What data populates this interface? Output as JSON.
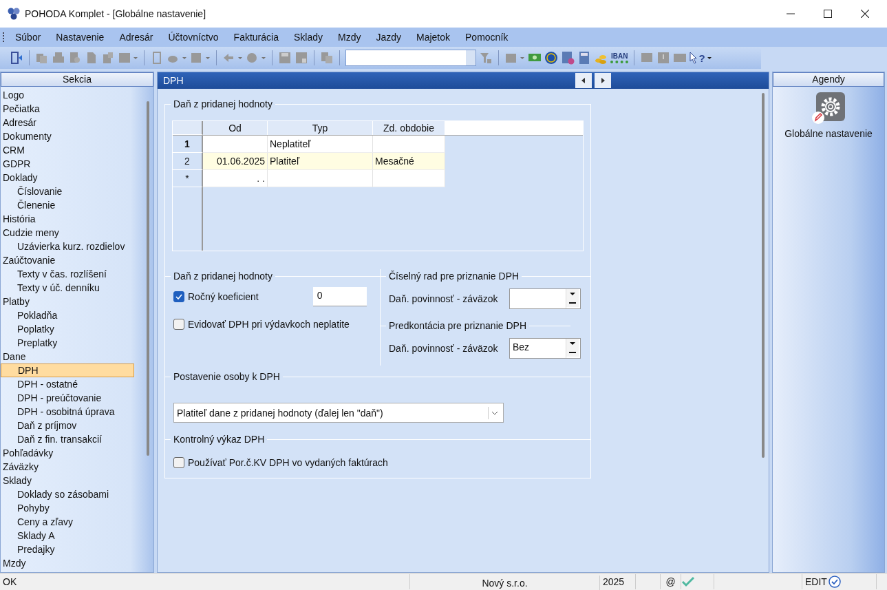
{
  "window": {
    "title": "POHODA Komplet - [Globálne nastavenie]"
  },
  "menu": [
    "Súbor",
    "Nastavenie",
    "Adresár",
    "Účtovníctvo",
    "Fakturácia",
    "Sklady",
    "Mzdy",
    "Jazdy",
    "Majetok",
    "Pomocník"
  ],
  "toolbar": {
    "iban_label": "IBAN",
    "help_mark": "?"
  },
  "sidebar": {
    "title": "Sekcia",
    "items": [
      {
        "label": "Logo",
        "selected": false
      },
      {
        "label": "Pečiatka",
        "selected": false
      },
      {
        "label": "Adresár",
        "selected": false
      },
      {
        "label": "Dokumenty",
        "selected": false
      },
      {
        "label": "CRM",
        "selected": false
      },
      {
        "label": "GDPR",
        "selected": false
      },
      {
        "label": "Doklady",
        "selected": false,
        "children": [
          {
            "label": "Číslovanie",
            "selected": false
          },
          {
            "label": "Členenie",
            "selected": false
          }
        ]
      },
      {
        "label": "História",
        "selected": false
      },
      {
        "label": "Cudzie meny",
        "selected": false,
        "children": [
          {
            "label": "Uzávierka kurz. rozdielov",
            "selected": false
          }
        ]
      },
      {
        "label": "Zaúčtovanie",
        "selected": false,
        "children": [
          {
            "label": "Texty v čas. rozlíšení",
            "selected": false
          },
          {
            "label": "Texty v úč. denníku",
            "selected": false
          }
        ]
      },
      {
        "label": "Platby",
        "selected": false,
        "children": [
          {
            "label": "Pokladňa",
            "selected": false
          },
          {
            "label": "Poplatky",
            "selected": false
          },
          {
            "label": "Preplatky",
            "selected": false
          }
        ]
      },
      {
        "label": "Dane",
        "selected": false,
        "children": [
          {
            "label": "DPH",
            "selected": true
          },
          {
            "label": "DPH - ostatné",
            "selected": false
          },
          {
            "label": "DPH - preúčtovanie",
            "selected": false
          },
          {
            "label": "DPH - osobitná úprava",
            "selected": false
          },
          {
            "label": "Daň z príjmov",
            "selected": false
          },
          {
            "label": "Daň z fin. transakcií",
            "selected": false
          }
        ]
      },
      {
        "label": "Pohľadávky",
        "selected": false
      },
      {
        "label": "Záväzky",
        "selected": false
      },
      {
        "label": "Sklady",
        "selected": false,
        "children": [
          {
            "label": "Doklady so zásobami",
            "selected": false
          },
          {
            "label": "Pohyby",
            "selected": false
          },
          {
            "label": "Ceny a zľavy",
            "selected": false
          },
          {
            "label": "Sklady A",
            "selected": false
          },
          {
            "label": "Predajky",
            "selected": false
          }
        ]
      },
      {
        "label": "Mzdy",
        "selected": false
      }
    ]
  },
  "page": {
    "title": "DPH",
    "group_title": "Daň z pridanej hodnoty",
    "table": {
      "columns": [
        "Od",
        "Typ",
        "Zd. obdobie"
      ],
      "rows": [
        {
          "header": "1",
          "selected": true,
          "highlighted": false,
          "cells": [
            null,
            "Neplatiteľ",
            null
          ]
        },
        {
          "header": "2",
          "selected": false,
          "highlighted": true,
          "cells": [
            "01.06.2025",
            "Platiteľ",
            "Mesačné"
          ]
        },
        {
          "header": "*",
          "selected": false,
          "highlighted": false,
          "cells": [
            ". .",
            null,
            null
          ]
        }
      ]
    },
    "vat_section": {
      "title": "Daň z pridanej hodnoty",
      "annual_coefficient": {
        "label": "Ročný koeficient",
        "checked": true,
        "value": "0"
      },
      "record_vat": {
        "label": "Evidovať DPH pri výdavkoch neplatite",
        "checked": false
      }
    },
    "number_series": {
      "title": "Číselný rad pre priznanie DPH",
      "label": "Daň. povinnosť - záväzok"
    },
    "predkontacia": {
      "title": "Predkontácia pre priznanie DPH",
      "label": "Daň. povinnosť - záväzok",
      "value": "Bez"
    },
    "person_status": {
      "title": "Postavenie osoby k DPH",
      "value": "Platiteľ dane z pridanej hodnoty (ďalej len \"daň\")"
    },
    "control_statement": {
      "title": "Kontrolný výkaz DPH",
      "label": "Používať Por.č.KV DPH vo vydaných faktúrach",
      "checked": false
    }
  },
  "agendy": {
    "title": "Agendy",
    "items": [
      {
        "label": "Globálne nastavenie"
      }
    ]
  },
  "status_bar": {
    "message": "OK",
    "company": "Nový s.r.o.",
    "year": "2025",
    "at": "@",
    "mode": "EDIT"
  }
}
